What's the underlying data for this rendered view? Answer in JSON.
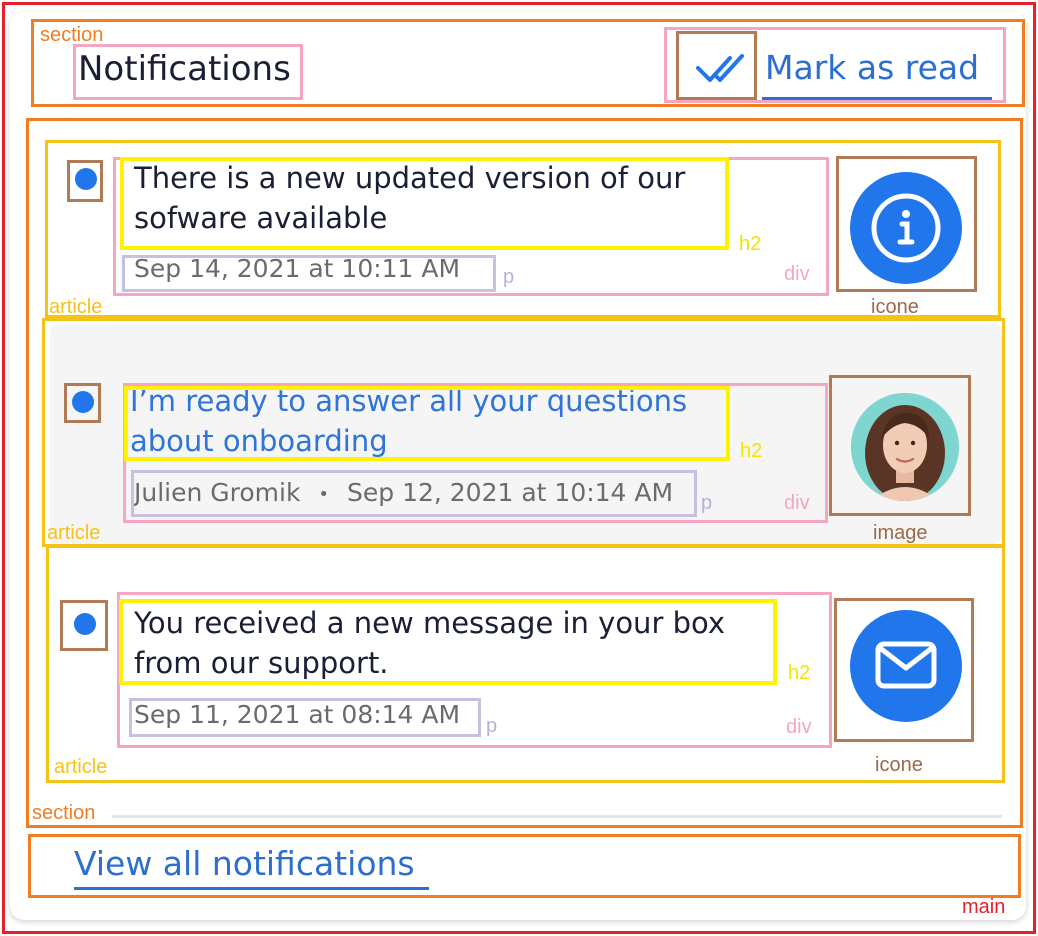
{
  "header": {
    "title": "Notifications",
    "mark_read_label": "Mark as read"
  },
  "notifications": [
    {
      "title": "There is a new updated version of our sofware available",
      "title_line1": "There is a new updated version of our",
      "title_line2": "sofware available",
      "date": "Sep 14, 2021 at 10:11 AM",
      "icon": "info-icon",
      "unread": true
    },
    {
      "title": "I'm ready to answer all your questions about onboarding",
      "title_line1": "I’m ready to answer all your questions",
      "title_line2": "about onboarding",
      "author": "Julien Gromik",
      "separator": "•",
      "date": "Sep 12, 2021 at 10:14 AM",
      "icon": "avatar-image",
      "unread": true,
      "highlighted": true
    },
    {
      "title": "You received a new message in your box from our support.",
      "title_line1": "You received a new message in your box",
      "title_line2": "from our support.",
      "date": "Sep 11, 2021 at 08:14 AM",
      "icon": "mail-icon",
      "unread": true
    }
  ],
  "footer": {
    "view_all_label": "View all notifications"
  },
  "annotations": {
    "section": "section",
    "article": "article",
    "h2": "h2",
    "p": "p",
    "div": "div",
    "icone": "icone",
    "image": "image",
    "main": "main"
  },
  "colors": {
    "accent": "#2176ec",
    "main_box": "#e8202a",
    "section_box": "#f07d22",
    "article_box": "#f5c218",
    "h2_box": "#fff200",
    "div_box": "#f4a6c2",
    "p_box": "#c8c0e0",
    "icon_box": "#b07a55",
    "highlight_bg": "#f5f5f5"
  }
}
